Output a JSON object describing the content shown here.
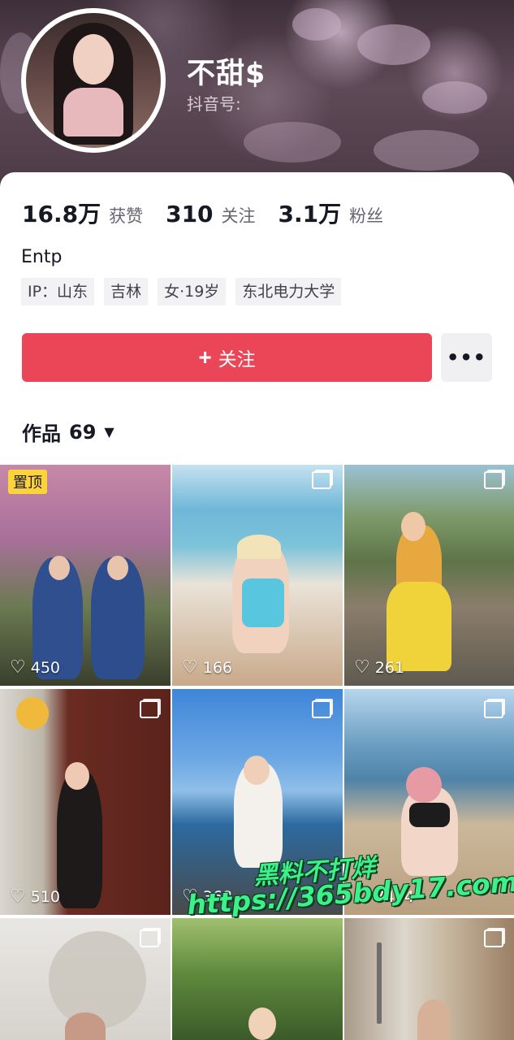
{
  "profile": {
    "username": "不甜$",
    "douyin_id_label": "抖音号:",
    "stats": [
      {
        "value": "16.8万",
        "label": "获赞"
      },
      {
        "value": "310",
        "label": "关注"
      },
      {
        "value": "3.1万",
        "label": "粉丝"
      }
    ],
    "bio": "Entp",
    "tags": [
      "IP：山东",
      "吉林",
      "女·19岁",
      "东北电力大学"
    ],
    "follow_label": "关注",
    "follow_icon": "plus-icon",
    "more_icon": "more-icon"
  },
  "works": {
    "label": "作品",
    "count": "69",
    "pinned_label": "置顶",
    "items": [
      {
        "likes": "450",
        "pinned": true
      },
      {
        "likes": "166"
      },
      {
        "likes": "261"
      },
      {
        "likes": "510"
      },
      {
        "likes": "368"
      },
      {
        "likes": "7404"
      },
      {
        "likes": ""
      },
      {
        "likes": ""
      },
      {
        "likes": ""
      }
    ]
  },
  "watermark": {
    "line1": "黑料不打烊",
    "line2": "https://365bdy17.com"
  },
  "colors": {
    "accent": "#ea4657",
    "pinned": "#fdd33c",
    "watermark": "#3cf08a"
  }
}
